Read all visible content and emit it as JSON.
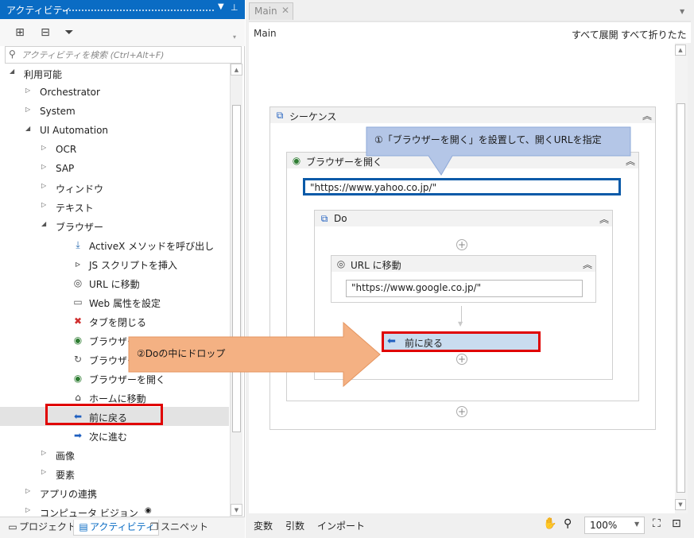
{
  "panel": {
    "title": "アクティビティ",
    "menu_icon": "dropdown-icon",
    "pin_icon": "pin-icon"
  },
  "toolbar": {
    "expand_all_icon": "expand-all-icon",
    "collapse_all_icon": "collapse-all-icon",
    "filter_icon": "filter-icon"
  },
  "search": {
    "placeholder": "アクティビティを検索 (Ctrl+Alt+F)"
  },
  "tree": {
    "items": [
      {
        "label": "利用可能",
        "level": 0,
        "expanded": true,
        "has_arrow": true
      },
      {
        "label": "Orchestrator",
        "level": 1,
        "expanded": false,
        "has_arrow": true
      },
      {
        "label": "System",
        "level": 1,
        "expanded": false,
        "has_arrow": true
      },
      {
        "label": "UI Automation",
        "level": 1,
        "expanded": true,
        "has_arrow": true
      },
      {
        "label": "OCR",
        "level": 2,
        "expanded": false,
        "has_arrow": true
      },
      {
        "label": "SAP",
        "level": 2,
        "expanded": false,
        "has_arrow": true
      },
      {
        "label": "ウィンドウ",
        "level": 2,
        "expanded": false,
        "has_arrow": true
      },
      {
        "label": "テキスト",
        "level": 2,
        "expanded": false,
        "has_arrow": true
      },
      {
        "label": "ブラウザー",
        "level": 2,
        "expanded": true,
        "has_arrow": true
      },
      {
        "label": "ActiveX メソッドを呼び出し",
        "level": 3,
        "icon": "download-arrow-icon",
        "glyph": "⤓",
        "color": "#2b6cb0"
      },
      {
        "label": "JS スクリプトを挿入",
        "level": 3,
        "icon": "terminal-icon",
        "glyph": "▹",
        "color": "#333333"
      },
      {
        "label": "URL に移動",
        "level": 3,
        "icon": "compass-icon",
        "glyph": "◎",
        "color": "#444444"
      },
      {
        "label": "Web 属性を設定",
        "level": 3,
        "icon": "attribute-icon",
        "glyph": "▭",
        "color": "#555555"
      },
      {
        "label": "タブを閉じる",
        "level": 3,
        "icon": "close-tab-icon",
        "glyph": "✖",
        "color": "#d03030"
      },
      {
        "label": "ブラウザーにアタッチ",
        "level": 3,
        "icon": "globe-icon",
        "glyph": "◉",
        "color": "#2e7d32"
      },
      {
        "label": "ブラウザーを更新",
        "level": 3,
        "icon": "refresh-icon",
        "glyph": "↻",
        "color": "#555555"
      },
      {
        "label": "ブラウザーを開く",
        "level": 3,
        "icon": "globe-icon",
        "glyph": "◉",
        "color": "#2e7d32"
      },
      {
        "label": "ホームに移動",
        "level": 3,
        "icon": "home-icon",
        "glyph": "⌂",
        "color": "#333333"
      },
      {
        "label": "前に戻る",
        "level": 3,
        "icon": "back-arrow-icon",
        "glyph": "⬅",
        "color": "#1f5fbf",
        "selected": true
      },
      {
        "label": "次に進む",
        "level": 3,
        "icon": "forward-arrow-icon",
        "glyph": "➡",
        "color": "#1f5fbf"
      },
      {
        "label": "画像",
        "level": 2,
        "expanded": false,
        "has_arrow": true
      },
      {
        "label": "要素",
        "level": 2,
        "expanded": false,
        "has_arrow": true
      },
      {
        "label": "アプリの連携",
        "level": 1,
        "expanded": false,
        "has_arrow": true
      },
      {
        "label": "コンピュータ ビジョン",
        "level": 1,
        "expanded": false,
        "has_arrow": true,
        "suffix_icon": "eye-icon"
      }
    ]
  },
  "bottom_tabs": [
    {
      "label": "プロジェクト",
      "icon": "project-icon",
      "active": false
    },
    {
      "label": "アクティビティ",
      "icon": "activities-icon",
      "active": true
    },
    {
      "label": "スニペット",
      "icon": "snippets-icon",
      "active": false
    }
  ],
  "designer": {
    "doc_tab_label": "Main",
    "breadcrumb": "Main",
    "expand_all": "すべて展開",
    "collapse_all": "すべて折りたたみ"
  },
  "workflow": {
    "sequence_title": "シーケンス",
    "open_browser_title": "ブラウザーを開く",
    "open_browser_url": "\"https://www.yahoo.co.jp/\"",
    "do_title": "Do",
    "navigate_title": "URL に移動",
    "navigate_url": "\"https://www.google.co.jp/\"",
    "dropped_activity": "前に戻る"
  },
  "annotations": {
    "callout_1": "①「ブラウザーを開く」を設置して、開くURLを指定",
    "callout_2": "②Doの中にドロップ"
  },
  "status_bar": {
    "variables": "変数",
    "arguments": "引数",
    "imports": "インポート",
    "zoom": "100%"
  },
  "colors": {
    "accent": "#0a6cc4",
    "highlight_red": "#e00000",
    "callout_blue": "#b4c6e7",
    "callout_orange": "#f4b183",
    "dropped_bg": "#c9dcef"
  }
}
